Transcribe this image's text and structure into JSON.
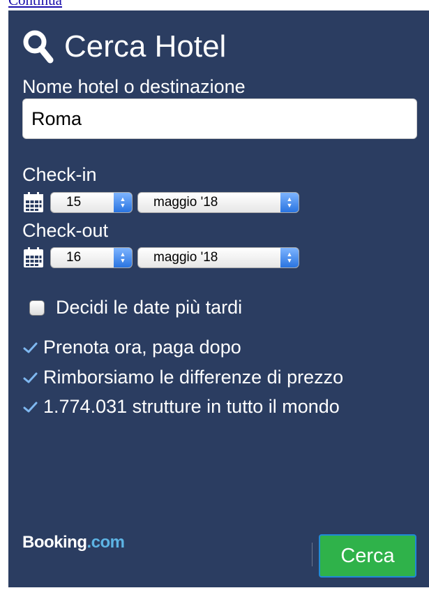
{
  "top_link": "Continua",
  "widget": {
    "title": "Cerca Hotel",
    "destination_label": "Nome hotel o destinazione",
    "destination_value": "Roma",
    "checkin": {
      "label": "Check-in",
      "day": "15",
      "month": "maggio '18"
    },
    "checkout": {
      "label": "Check-out",
      "day": "16",
      "month": "maggio '18"
    },
    "flexible_dates_label": "Decidi le date più tardi",
    "features": [
      "Prenota ora, paga dopo",
      "Rimborsiamo le differenze di prezzo",
      "1.774.031 strutture in tutto il mondo"
    ],
    "logo": {
      "brand": "Booking",
      "tld": ".com"
    },
    "search_button": "Cerca"
  },
  "colors": {
    "panel_bg": "#2b3d61",
    "button_green": "#2fb24a",
    "logo_accent": "#5db4e4",
    "spinner_blue": "#2a74e0"
  },
  "icons": [
    "search-icon",
    "calendar-icon",
    "checkmark-icon"
  ]
}
